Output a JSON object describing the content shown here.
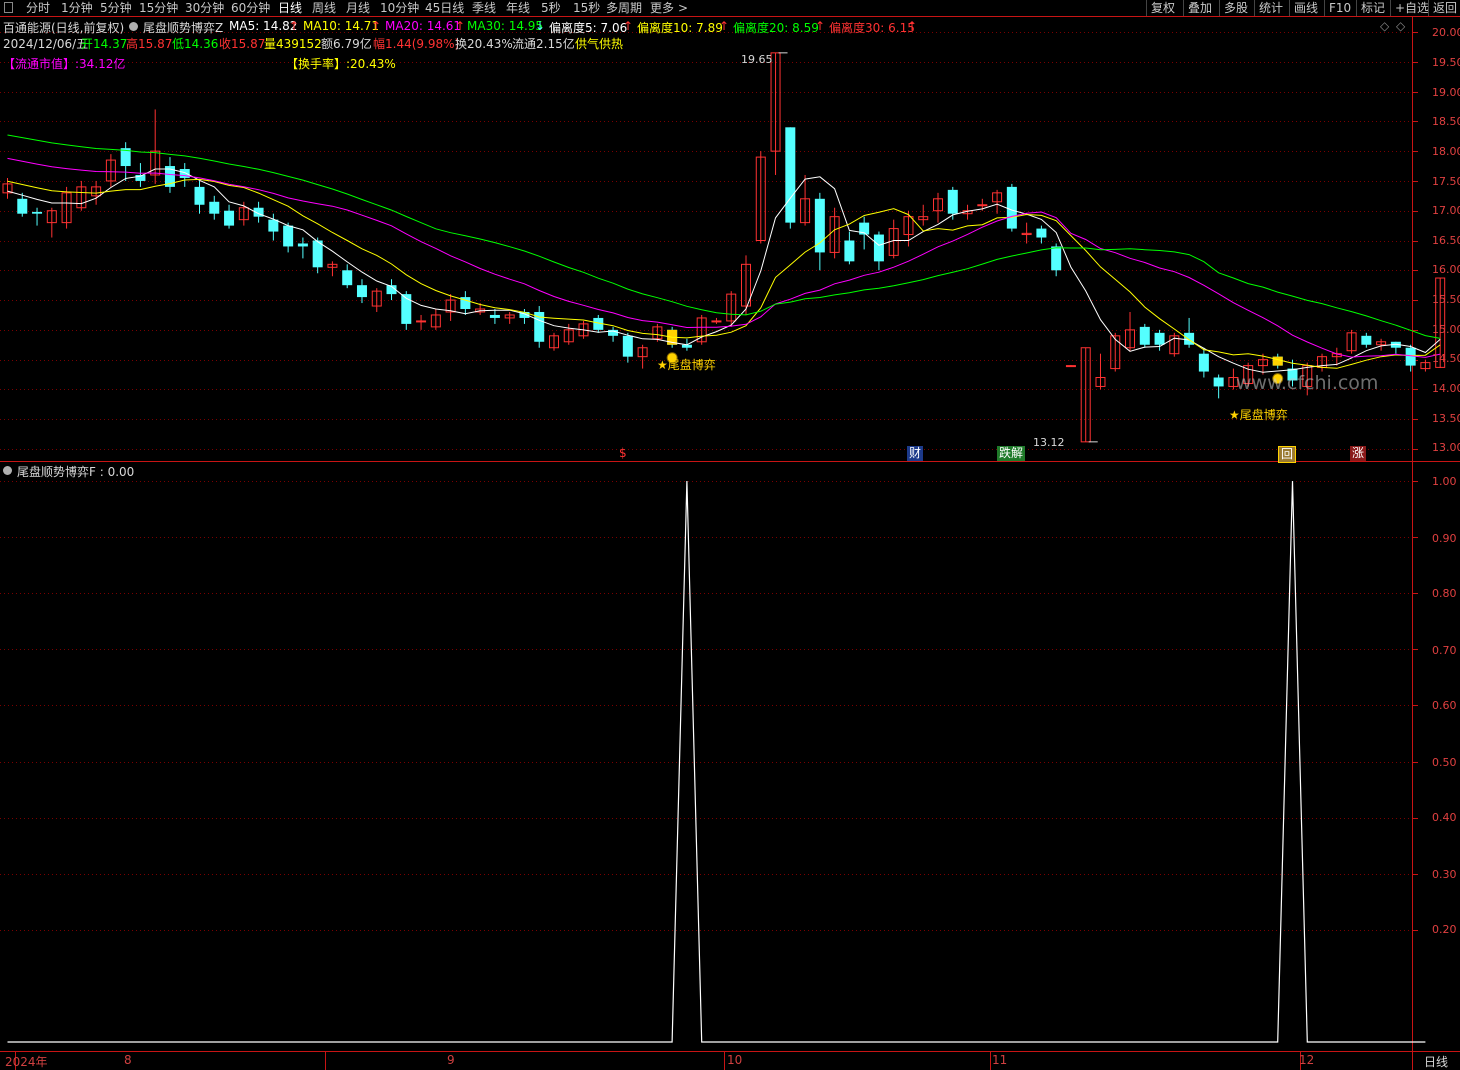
{
  "topbar": {
    "tabs": [
      "分时",
      "1分钟",
      "5分钟",
      "15分钟",
      "30分钟",
      "60分钟",
      "日线",
      "周线",
      "月线",
      "10分钟",
      "45日线",
      "季线",
      "年线",
      "5秒",
      "15秒",
      "多周期",
      "更多"
    ],
    "active_tab": "日线",
    "more_arrow": ">",
    "buttons": [
      "复权",
      "叠加",
      "多股",
      "统计",
      "画线",
      "F10",
      "标记",
      "+自选",
      "返回"
    ]
  },
  "header": {
    "stock": "百通能源(日线,前复权)",
    "indicator": "尾盘顺势博弈Z",
    "ma5": "MA5: 14.82",
    "ma10": "MA10: 14.71",
    "ma20": "MA20: 14.61",
    "ma30": "MA30: 14.95",
    "dev5": "偏离度5: 7.06",
    "dev10": "偏离度10: 7.89",
    "dev20": "偏离度20: 8.59",
    "dev30": "偏离度30: 6.15",
    "date": "2024/12/06/五",
    "open": "开14.37",
    "high": "高15.87",
    "low": "低14.36",
    "close": "收15.87",
    "vol": "量439152",
    "amount": "额6.79亿",
    "change": "幅1.44(9.98%)",
    "turnover": "换20.43%",
    "float_shares": "流通2.15亿",
    "tag": "供气供热",
    "float_cap_label": "【流通市值】:34.12亿",
    "turnover_label": "【换手率】:20.43%"
  },
  "lower": {
    "title": "尾盘顺势博弈F : 0.00"
  },
  "events": {
    "dollar": "$",
    "cai": "财",
    "jiejie": "跌解",
    "hui": "回",
    "zhang": "涨"
  },
  "signals": [
    "尾盘博弈",
    "尾盘博弈"
  ],
  "max_label": "19.65",
  "min_label": "13.12",
  "x_axis": {
    "labels": [
      "2024年",
      "8",
      "9",
      "10",
      "11",
      "12"
    ],
    "right": "日线"
  },
  "watermark": "www.cfchi.com",
  "colors": {
    "bg": "#000000",
    "up": "#ff3232",
    "down": "#54ffff",
    "ma5": "#ffffff",
    "ma10": "#ffff00",
    "ma20": "#ff00ff",
    "ma30": "#00ff00",
    "grid": "#7a0000",
    "axis": "#c81414",
    "signal": "#ffd200",
    "lower_line": "#ffffff"
  },
  "chart_data": [
    {
      "type": "candlestick",
      "series_names": [
        "MA5",
        "MA10",
        "MA20",
        "MA30"
      ],
      "ylim": [
        12.95,
        20.1
      ],
      "yticks": [
        13.0,
        13.5,
        14.0,
        14.5,
        15.0,
        15.5,
        16.0,
        16.5,
        17.0,
        17.5,
        18.0,
        18.5,
        19.0,
        19.5,
        20.0
      ],
      "candles": [
        [
          17.3,
          17.45,
          17.2,
          17.55
        ],
        [
          17.2,
          16.95,
          16.9,
          17.3
        ],
        [
          16.98,
          16.95,
          16.75,
          17.05
        ],
        [
          16.8,
          17.0,
          16.55,
          17.05
        ],
        [
          16.8,
          17.3,
          16.7,
          17.4
        ],
        [
          17.05,
          17.4,
          17.0,
          17.5
        ],
        [
          17.25,
          17.4,
          17.1,
          17.5
        ],
        [
          17.5,
          17.85,
          17.4,
          17.95
        ],
        [
          18.05,
          17.75,
          17.5,
          18.15
        ],
        [
          17.6,
          17.5,
          17.4,
          17.8
        ],
        [
          17.6,
          18.0,
          17.45,
          18.7
        ],
        [
          17.75,
          17.4,
          17.3,
          17.9
        ],
        [
          17.7,
          17.55,
          17.4,
          17.8
        ],
        [
          17.4,
          17.1,
          16.95,
          17.5
        ],
        [
          17.15,
          16.95,
          16.85,
          17.25
        ],
        [
          17.0,
          16.75,
          16.7,
          17.1
        ],
        [
          16.85,
          17.05,
          16.75,
          17.15
        ],
        [
          17.05,
          16.9,
          16.8,
          17.15
        ],
        [
          16.85,
          16.65,
          16.5,
          16.95
        ],
        [
          16.75,
          16.4,
          16.3,
          16.8
        ],
        [
          16.45,
          16.4,
          16.2,
          16.55
        ],
        [
          16.5,
          16.05,
          15.95,
          16.55
        ],
        [
          16.05,
          16.1,
          15.9,
          16.15
        ],
        [
          16.0,
          15.75,
          15.7,
          16.1
        ],
        [
          15.75,
          15.55,
          15.45,
          15.85
        ],
        [
          15.4,
          15.65,
          15.3,
          15.7
        ],
        [
          15.75,
          15.6,
          15.5,
          15.85
        ],
        [
          15.6,
          15.1,
          15.0,
          15.65
        ],
        [
          15.15,
          15.15,
          15.0,
          15.25
        ],
        [
          15.05,
          15.25,
          15.0,
          15.35
        ],
        [
          15.3,
          15.5,
          15.15,
          15.6
        ],
        [
          15.55,
          15.35,
          15.25,
          15.65
        ],
        [
          15.3,
          15.35,
          15.25,
          15.45
        ],
        [
          15.25,
          15.2,
          15.1,
          15.35
        ],
        [
          15.2,
          15.25,
          15.1,
          15.3
        ],
        [
          15.3,
          15.2,
          15.1,
          15.35
        ],
        [
          15.3,
          14.8,
          14.7,
          15.4
        ],
        [
          14.7,
          14.9,
          14.65,
          14.95
        ],
        [
          14.8,
          15.0,
          14.75,
          15.1
        ],
        [
          14.9,
          15.1,
          14.85,
          15.15
        ],
        [
          15.2,
          15.0,
          14.95,
          15.25
        ],
        [
          15.0,
          14.9,
          14.8,
          15.05
        ],
        [
          14.9,
          14.55,
          14.45,
          14.95
        ],
        [
          14.55,
          14.7,
          14.35,
          14.75
        ],
        [
          14.85,
          15.05,
          14.8,
          15.1
        ],
        [
          15.0,
          14.75,
          14.7,
          15.05
        ],
        [
          14.75,
          14.7,
          14.65,
          14.85
        ],
        [
          14.8,
          15.2,
          14.75,
          15.25
        ],
        [
          15.15,
          15.15,
          15.1,
          15.2
        ],
        [
          15.15,
          15.6,
          15.05,
          15.65
        ],
        [
          15.4,
          16.1,
          15.25,
          16.25
        ],
        [
          16.5,
          17.9,
          16.45,
          18.0
        ],
        [
          18.0,
          19.65,
          17.6,
          19.65
        ],
        [
          18.4,
          16.8,
          16.7,
          18.4
        ],
        [
          16.8,
          17.2,
          16.75,
          17.6
        ],
        [
          17.2,
          16.3,
          16.0,
          17.3
        ],
        [
          16.3,
          16.9,
          16.2,
          17.05
        ],
        [
          16.5,
          16.15,
          16.1,
          16.65
        ],
        [
          16.8,
          16.6,
          16.35,
          16.9
        ],
        [
          16.6,
          16.15,
          16.0,
          16.65
        ],
        [
          16.25,
          16.7,
          16.2,
          16.85
        ],
        [
          16.6,
          16.9,
          16.4,
          17.0
        ],
        [
          16.85,
          16.9,
          16.75,
          17.1
        ],
        [
          17.0,
          17.2,
          16.8,
          17.3
        ],
        [
          17.35,
          16.95,
          16.85,
          17.4
        ],
        [
          16.95,
          17.0,
          16.85,
          17.1
        ],
        [
          17.1,
          17.1,
          17.0,
          17.2
        ],
        [
          17.15,
          17.3,
          16.95,
          17.35
        ],
        [
          17.4,
          16.7,
          16.65,
          17.45
        ],
        [
          16.6,
          16.62,
          16.45,
          16.8
        ],
        [
          16.7,
          16.55,
          16.45,
          16.75
        ],
        [
          16.4,
          16.0,
          15.9,
          16.45
        ],
        [
          14.4,
          14.4,
          14.39,
          14.41
        ],
        [
          13.12,
          14.7,
          13.12,
          14.7
        ],
        [
          14.05,
          14.2,
          14.0,
          14.6
        ],
        [
          14.35,
          14.9,
          14.3,
          14.95
        ],
        [
          14.7,
          15.0,
          14.65,
          15.3
        ],
        [
          15.05,
          14.75,
          14.7,
          15.1
        ],
        [
          14.95,
          14.75,
          14.65,
          15.0
        ],
        [
          14.6,
          14.9,
          14.55,
          14.95
        ],
        [
          14.95,
          14.75,
          14.7,
          15.2
        ],
        [
          14.6,
          14.3,
          14.2,
          14.7
        ],
        [
          14.2,
          14.05,
          13.85,
          14.25
        ],
        [
          14.05,
          14.2,
          14.0,
          14.35
        ],
        [
          14.1,
          14.4,
          14.05,
          14.45
        ],
        [
          14.4,
          14.5,
          14.25,
          14.6
        ],
        [
          14.55,
          14.4,
          14.35,
          14.6
        ],
        [
          14.35,
          14.15,
          14.05,
          14.5
        ],
        [
          14.05,
          14.4,
          13.9,
          14.45
        ],
        [
          14.37,
          14.55,
          14.3,
          14.6
        ],
        [
          14.55,
          14.6,
          14.4,
          14.7
        ],
        [
          14.65,
          14.95,
          14.6,
          15.0
        ],
        [
          14.9,
          14.75,
          14.7,
          14.95
        ],
        [
          14.75,
          14.8,
          14.65,
          14.85
        ],
        [
          14.8,
          14.7,
          14.6,
          14.8
        ],
        [
          14.7,
          14.4,
          14.3,
          14.75
        ],
        [
          14.35,
          14.45,
          14.3,
          14.5
        ],
        [
          14.37,
          15.87,
          14.36,
          15.87
        ]
      ]
    },
    {
      "type": "line",
      "series_name": "尾盘顺势博弈F",
      "ylim": [
        0,
        1.0
      ],
      "yticks": [
        0.2,
        0.3,
        0.4,
        0.5,
        0.6,
        0.7,
        0.8,
        0.9,
        1.0
      ],
      "points": [
        [
          0,
          0
        ],
        [
          45,
          0
        ],
        [
          46,
          1
        ],
        [
          47,
          0
        ],
        [
          86,
          0
        ],
        [
          87,
          1
        ],
        [
          88,
          0
        ],
        [
          96,
          0
        ]
      ]
    }
  ]
}
